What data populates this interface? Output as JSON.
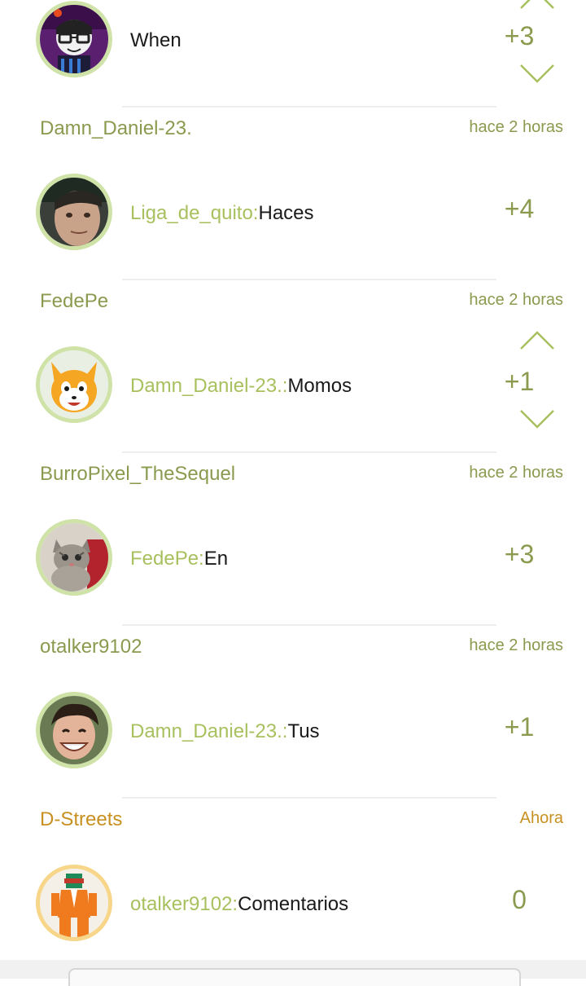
{
  "comments": [
    {
      "username": "",
      "time": "",
      "reply_to": "",
      "text": "When",
      "score": "+3",
      "upvote_icon": "chevron-up-icon",
      "downvote_icon": "chevron-down-icon",
      "avatar_icon": "avatar-cartoon-glasses"
    },
    {
      "username": "Damn_Daniel-23.",
      "time": "hace 2 horas",
      "reply_to": "Liga_de_quito:",
      "text": "Haces",
      "score": "+4",
      "avatar_icon": "avatar-person-face"
    },
    {
      "username": "FedePe",
      "time": "hace 2 horas",
      "reply_to": "Damn_Daniel-23.:",
      "text": "Momos",
      "score": "+1",
      "upvote_icon": "chevron-up-icon",
      "downvote_icon": "chevron-down-icon",
      "avatar_icon": "avatar-fox-cartoon"
    },
    {
      "username": "BurroPixel_TheSequel",
      "time": "hace 2 horas",
      "reply_to": "FedePe:",
      "text": "En",
      "score": "+3",
      "avatar_icon": "avatar-kitten"
    },
    {
      "username": "otalker9102",
      "time": "hace 2 horas",
      "reply_to": "Damn_Daniel-23.:",
      "text": "Tus",
      "score": "+1",
      "avatar_icon": "avatar-grinning-person"
    },
    {
      "username": "D-Streets",
      "time": "Ahora",
      "reply_to": "otalker9102:",
      "text": "Comentarios",
      "score": "0",
      "avatar_icon": "avatar-orange-suit"
    }
  ],
  "colors": {
    "accent": "#8a9a4e",
    "reply_name": "#a8c05e",
    "highlight": "#c89020",
    "avatar_ring": "#cfe3a8",
    "avatar_ring_gold": "#f7d68a"
  }
}
